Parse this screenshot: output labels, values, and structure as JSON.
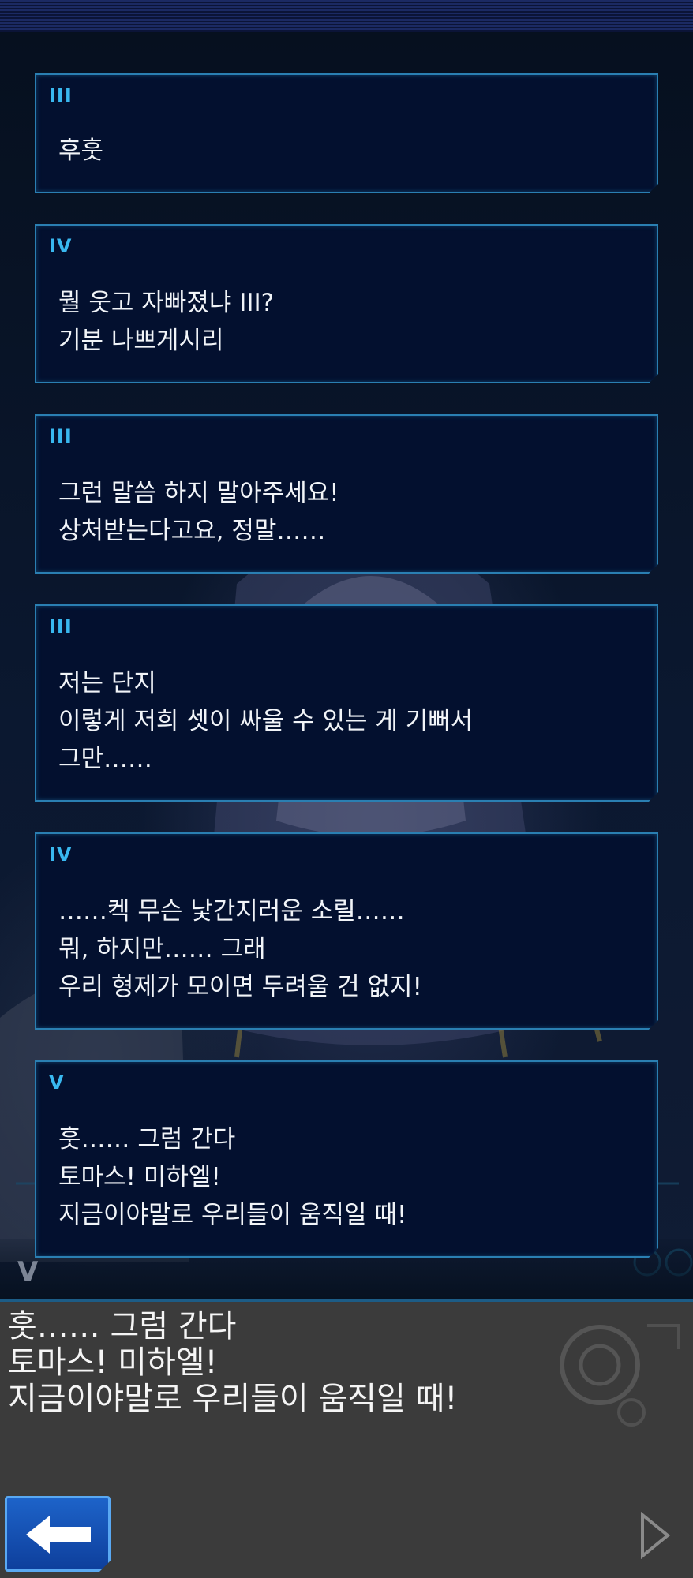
{
  "log": [
    {
      "speaker": "III",
      "lines": [
        "후훗"
      ]
    },
    {
      "speaker": "IV",
      "lines": [
        "뭘 웃고 자빠졌냐 III?",
        "기분 나쁘게시리"
      ]
    },
    {
      "speaker": "III",
      "lines": [
        "그런 말씀 하지 말아주세요!",
        "상처받는다고요, 정말……"
      ]
    },
    {
      "speaker": "III",
      "lines": [
        "저는 단지",
        "이렇게 저희 셋이 싸울 수 있는 게 기뻐서",
        "그만……"
      ]
    },
    {
      "speaker": "IV",
      "lines": [
        "……켁 무슨 낯간지러운 소릴……",
        "뭐, 하지만…… 그래",
        "우리 형제가 모이면 두려울 건 없지!"
      ]
    },
    {
      "speaker": "V",
      "lines": [
        "훗…… 그럼 간다",
        "토마스! 미하엘!",
        "지금이야말로 우리들이 움직일 때!"
      ]
    }
  ],
  "current": {
    "speaker": "V",
    "lines": [
      "훗…… 그럼 간다",
      "토마스! 미하엘!",
      "지금이야말로 우리들이 움직일 때!"
    ]
  },
  "controls": {
    "back_icon": "arrow-left-icon",
    "next_icon": "triangle-right-icon"
  },
  "colors": {
    "speaker": "#39b8f0",
    "box_bg": "#03102f",
    "box_border": "#2a7fb2",
    "bottom_panel": "#3b3b3b",
    "back_button": "#1d63c9"
  }
}
